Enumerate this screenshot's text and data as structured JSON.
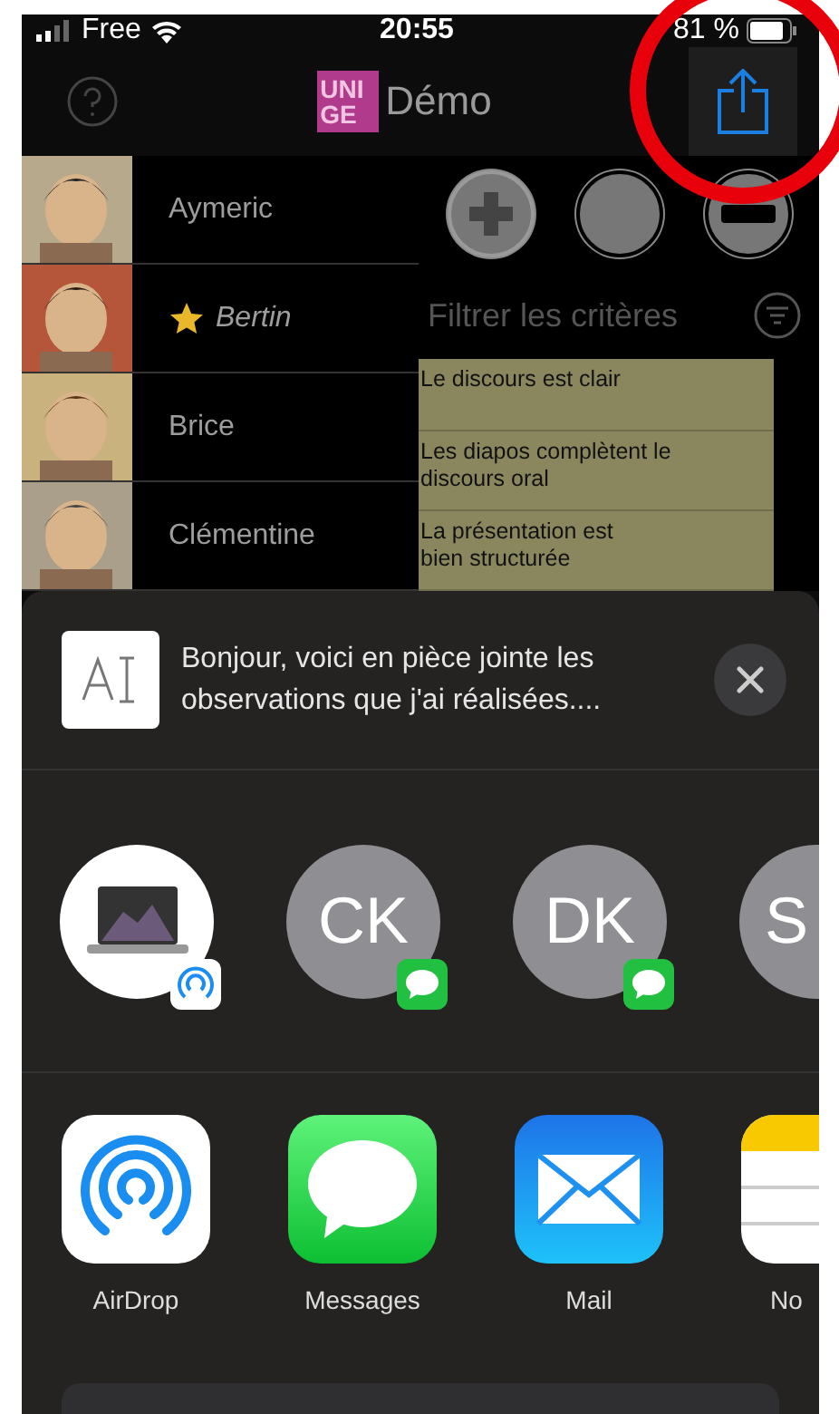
{
  "status_bar": {
    "carrier": "Free",
    "time": "20:55",
    "battery": "81 %"
  },
  "nav": {
    "logo_lines": [
      "UNI",
      "GE"
    ],
    "title": "Démo"
  },
  "students": [
    {
      "name": "Aymeric",
      "starred": false
    },
    {
      "name": "Bertin",
      "starred": true
    },
    {
      "name": "Brice",
      "starred": false
    },
    {
      "name": "Clémentine",
      "starred": false
    }
  ],
  "controls": [
    {
      "kind": "plus"
    },
    {
      "kind": "blank"
    },
    {
      "kind": "minus"
    }
  ],
  "filter": {
    "placeholder": "Filtrer les critères"
  },
  "criteria": [
    "Le discours est clair",
    "Les diapos complètent le\ndiscours oral",
    "La présentation est\nbien structurée"
  ],
  "share_sheet": {
    "message": "Bonjour, voici en pièce jointe les\nobservations que j'ai réalisées....",
    "targets": [
      {
        "kind": "device"
      },
      {
        "kind": "contact",
        "initials": "CK"
      },
      {
        "kind": "contact",
        "initials": "DK"
      },
      {
        "kind": "contact",
        "initials": "S"
      }
    ],
    "apps": [
      {
        "kind": "airdrop",
        "label": "AirDrop"
      },
      {
        "kind": "messages",
        "label": "Messages"
      },
      {
        "kind": "mail",
        "label": "Mail"
      },
      {
        "kind": "notes",
        "label": "No"
      }
    ]
  }
}
